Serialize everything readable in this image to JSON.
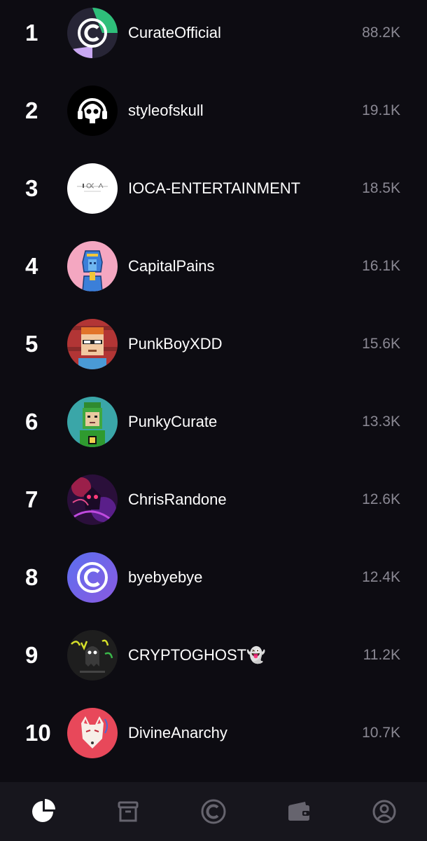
{
  "leaderboard": [
    {
      "rank": "1",
      "name": "CurateOfficial",
      "count": "88.2K",
      "avatar": "curate-logo-avatar"
    },
    {
      "rank": "2",
      "name": "styleofskull",
      "count": "19.1K",
      "avatar": "skull-avatar"
    },
    {
      "rank": "3",
      "name": "IOCA-ENTERTAINMENT",
      "count": "18.5K",
      "avatar": "ioca-logo-avatar"
    },
    {
      "rank": "4",
      "name": "CapitalPains",
      "count": "16.1K",
      "avatar": "pharaoh-avatar"
    },
    {
      "rank": "5",
      "name": "PunkBoyXDD",
      "count": "15.6K",
      "avatar": "pixel-punk-avatar"
    },
    {
      "rank": "6",
      "name": "PunkyCurate",
      "count": "13.3K",
      "avatar": "green-pixel-avatar"
    },
    {
      "rank": "7",
      "name": "ChrisRandone",
      "count": "12.6K",
      "avatar": "purple-art-avatar"
    },
    {
      "rank": "8",
      "name": "byebyebye",
      "count": "12.4K",
      "avatar": "curate-blue-avatar"
    },
    {
      "rank": "9",
      "name": "CRYPTOGHOST👻",
      "count": "11.2K",
      "avatar": "ghost-graffiti-avatar"
    },
    {
      "rank": "10",
      "name": "DivineAnarchy",
      "count": "10.7K",
      "avatar": "fox-mask-avatar"
    }
  ],
  "nav": [
    {
      "icon": "pie-chart-icon",
      "active": true
    },
    {
      "icon": "archive-box-icon",
      "active": false
    },
    {
      "icon": "curate-logo-icon",
      "active": false
    },
    {
      "icon": "wallet-icon",
      "active": false
    },
    {
      "icon": "profile-icon",
      "active": false
    }
  ],
  "colors": {
    "background": "#0d0c12",
    "navbar": "#17161d",
    "count_text": "#8a8893",
    "icon_inactive": "#66646e",
    "icon_active": "#ffffff"
  }
}
